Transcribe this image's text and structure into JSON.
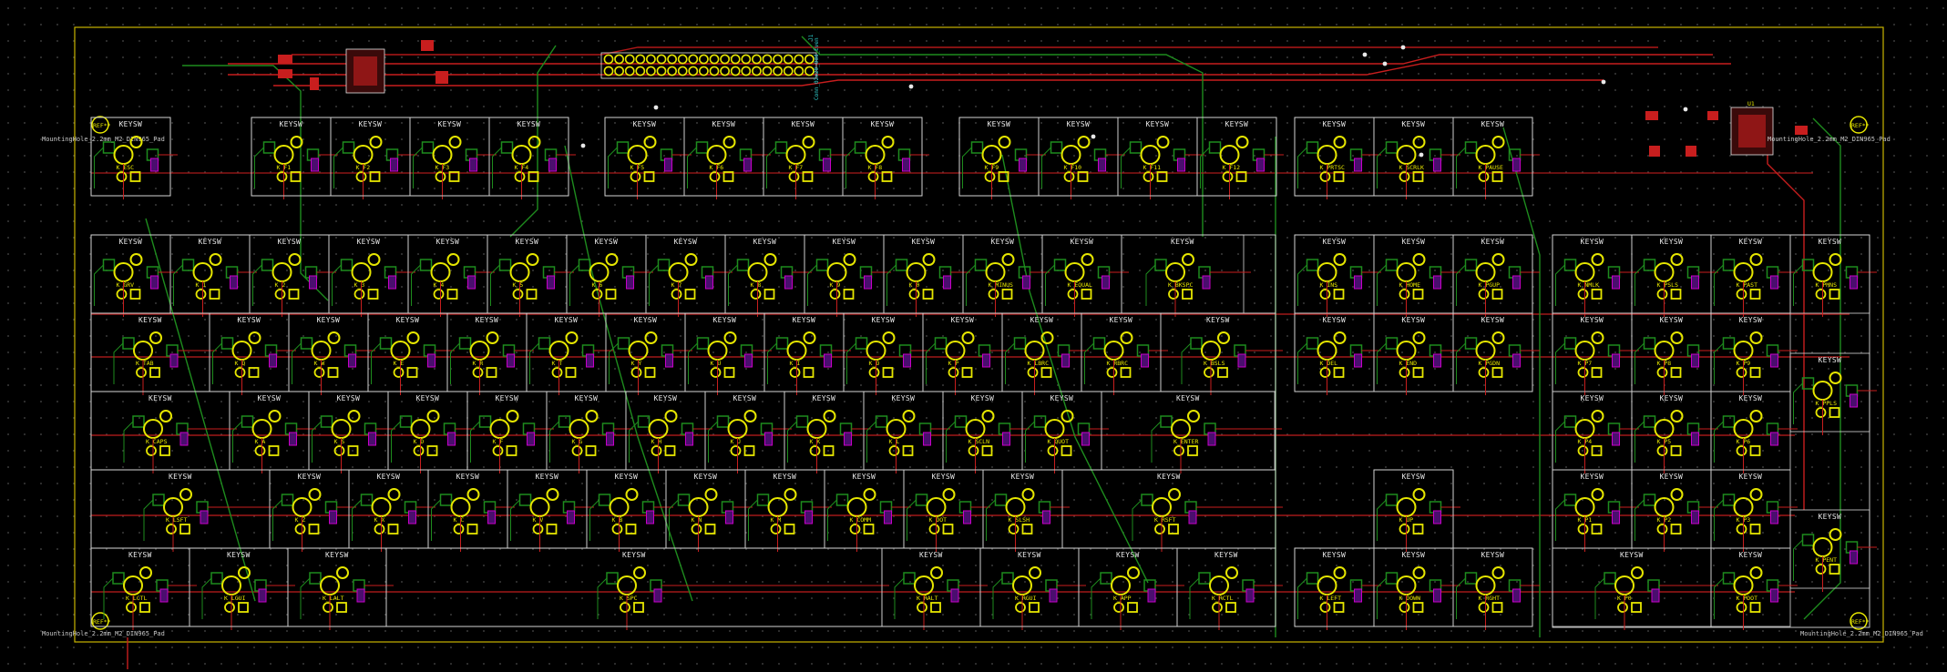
{
  "board": {
    "background": "#000000",
    "outline_color": "#c8b400",
    "copper_front": "#c81e1e",
    "copper_back": "#1e8c1e",
    "silkscreen": "#e8e8e8",
    "pad_color": "#e6e600",
    "mounting_hole_label": "MountingHole_2.2mm_M2_DIN965_Pad",
    "mounting_hole_ref": "REF**",
    "footprint_value": "KEYSW"
  },
  "header": {
    "ref": "J1",
    "value": "Conn_02x20_Odd_Even",
    "pins_per_row": 20
  },
  "controller": {
    "ref": "U1"
  },
  "keys": {
    "row0": [
      "K_ESC",
      "K_F1",
      "K_F2",
      "K_F3",
      "K_F4",
      "K_F5",
      "K_F6",
      "K_F7",
      "K_F8",
      "K_F9",
      "K_F10",
      "K_F11",
      "K_F12",
      "K_PRTSC",
      "K_SCRLK",
      "K_PAUSE"
    ],
    "row1": [
      "K_GRV",
      "K_1",
      "K_2",
      "K_3",
      "K_4",
      "K_5",
      "K_6",
      "K_7",
      "K_8",
      "K_9",
      "K_0",
      "K_MINUS",
      "K_EQUAL",
      "K_BKSPC",
      "K_INS",
      "K_HOME",
      "K_PGUP",
      "K_NMLK",
      "K_PSLS",
      "K_PAST",
      "K_PMNS"
    ],
    "row2": [
      "K_TAB",
      "K_Q",
      "K_W",
      "K_E",
      "K_R",
      "K_T",
      "K_Y",
      "K_U",
      "K_I",
      "K_O",
      "K_P",
      "K_LBRC",
      "K_RBRC",
      "K_BSLS",
      "K_DEL",
      "K_END",
      "K_PGDN",
      "K_P7",
      "K_P8",
      "K_P9",
      "K_PPLS"
    ],
    "row3": [
      "K_CAPS",
      "K_A",
      "K_S",
      "K_D",
      "K_F",
      "K_G",
      "K_H",
      "K_J",
      "K_K",
      "K_L",
      "K_SCLN",
      "K_QUOT",
      "K_ENTER",
      "K_P4",
      "K_P5",
      "K_P6"
    ],
    "row4": [
      "K_LSFT",
      "K_Z",
      "K_X",
      "K_C",
      "K_V",
      "K_B",
      "K_N",
      "K_M",
      "K_COMM",
      "K_DOT",
      "K_SLSH",
      "K_RSFT",
      "K_UP",
      "K_P1",
      "K_P2",
      "K_P3",
      "K_PENT"
    ],
    "row5": [
      "K_LCTL",
      "K_LGUI",
      "K_LALT",
      "K_SPC",
      "K_RALT",
      "K_RGUI",
      "K_APP",
      "K_RCTL",
      "K_LEFT",
      "K_DOWN",
      "K_RGHT",
      "K_P0",
      "K_PDOT"
    ]
  }
}
